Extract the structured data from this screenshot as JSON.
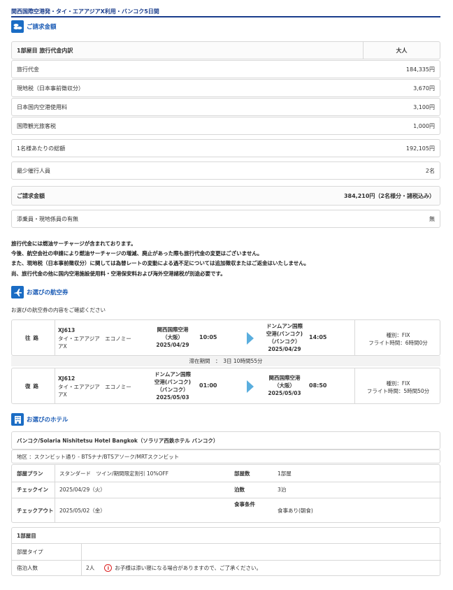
{
  "page_title": "関西国際空港発・タイ・エアアジアX利用・バンコク5日間",
  "billing": {
    "section_title": "ご請求金額",
    "header": {
      "label": "1部屋目 旅行代金内訳",
      "col": "大人"
    },
    "rows": [
      {
        "label": "旅行代金",
        "value": "184,335円"
      },
      {
        "label": "現地税（日本事前徴収分）",
        "value": "3,670円"
      },
      {
        "label": "日本国内空港使用料",
        "value": "3,100円"
      },
      {
        "label": "国際観光旅客税",
        "value": "1,000円"
      },
      {
        "label": "1名様あたりの総額",
        "value": "192,105円"
      },
      {
        "label": "最少催行人員",
        "value": "2名"
      },
      {
        "label": "ご請求金額",
        "value": "384,210円（2名様分・諸税込み）"
      },
      {
        "label": "添乗員・現地係員の有無",
        "value": "無"
      }
    ]
  },
  "notes": [
    "旅行代金には燃油サーチャージが含まれております。",
    "今後、航空会社の申請により燃油サーチャージの増減、廃止があった際も旅行代金の変更はございません。",
    "また、現地税（日本事前徴収分）に関しては為替レートの変動による過不足については追加徴収またはご返金はいたしません。",
    "尚、旅行代金の他に国内空港施設使用料・空港保安料および海外空港諸税が別途必要です。"
  ],
  "flight": {
    "section_title": "お選びの航空券",
    "subtitle": "お選びの航空券の内容をご確認ください",
    "stay": "滞在期間　：　3日 10時間55分",
    "legs": [
      {
        "direction": "往路",
        "flight_no": "XJ613",
        "airline": "タイ・エアアジア　エコノミー",
        "airline2": "アX",
        "dep_line1": "関西国際空港",
        "dep_line2": "（大阪）",
        "dep_date": "2025/04/29",
        "dep_time": "10:05",
        "arr_line1": "ドンムアン国際",
        "arr_line2": "空港(バンコク)",
        "arr_line3": "（バンコク）",
        "arr_date": "2025/04/29",
        "arr_time": "14:05",
        "kind": "種別：FIX",
        "duration": "フライト時間：6時間0分"
      },
      {
        "direction": "復路",
        "flight_no": "XJ612",
        "airline": "タイ・エアアジア　エコノミー",
        "airline2": "アX",
        "dep_line1": "ドンムアン国際",
        "dep_line2": "空港(バンコク)",
        "dep_line3": "（バンコク）",
        "dep_date": "2025/05/03",
        "dep_time": "01:00",
        "arr_line1": "関西国際空港",
        "arr_line2": "（大阪）",
        "arr_date": "2025/05/03",
        "arr_time": "08:50",
        "kind": "種別：FIX",
        "duration": "フライト時間：5時間50分"
      }
    ]
  },
  "hotel": {
    "section_title": "お選びのホテル",
    "name": "バンコク/Solaria Nishitetsu Hotel Bangkok（ソラリア西鉄ホテル バンコク）",
    "area": "地区 ：スクンビット通り - BTSナナ/BTSアソーク/MRTスクンビット",
    "plan_label": "部屋プラン",
    "plan_value": "スタンダード　ツイン/期間限定割引 10%OFF",
    "rooms_label": "部屋数",
    "rooms_value": "1部屋",
    "checkin_label": "チェックイン",
    "checkin_value": "2025/04/29（火）",
    "nights_label": "泊数",
    "nights_value": "3泊",
    "checkout_label": "チェックアウト",
    "checkout_value": "2025/05/02（金）",
    "meal_label": "食事条件",
    "meal_value": "食事あり(朝食)",
    "room1_title": "1部屋目",
    "roomtype_label": "部屋タイプ",
    "roomtype_value": "",
    "guests_label": "宿泊人数",
    "guests_value": "2人",
    "guests_note": "お子様は添い寝になる場合がありますので、ご了承ください。"
  }
}
